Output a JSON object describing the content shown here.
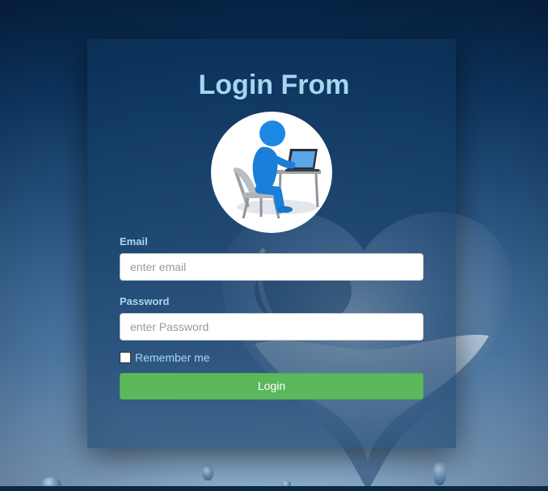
{
  "form": {
    "title": "Login From",
    "email": {
      "label": "Email",
      "placeholder": "enter email",
      "value": ""
    },
    "password": {
      "label": "Password",
      "placeholder": "enter Password",
      "value": ""
    },
    "remember": {
      "label": "Remember me",
      "checked": false
    },
    "submit_label": "Login"
  },
  "icons": {
    "avatar": "user-at-laptop-icon"
  },
  "colors": {
    "title": "#a9d6ef",
    "button": "#5cb85c",
    "card_overlay": "#0e345c"
  }
}
